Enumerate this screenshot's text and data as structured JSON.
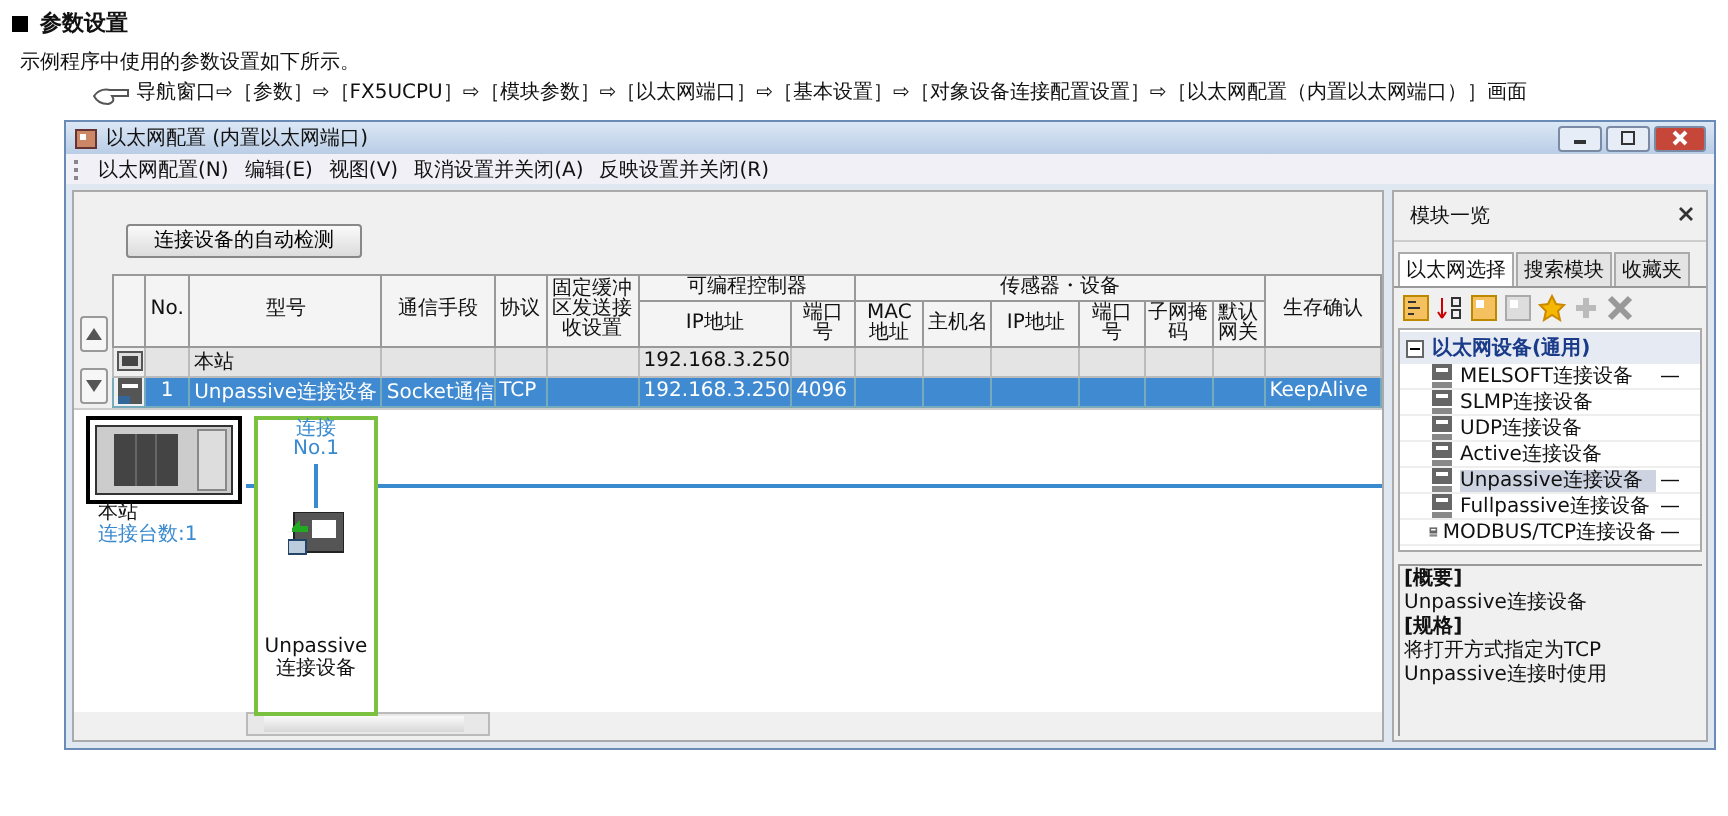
{
  "heading": "参数设置",
  "intro": "示例程序中使用的参数设置如下所示。",
  "nav_path": "导航窗口⇨［参数］⇨［FX5UCPU］⇨［模块参数］⇨［以太网端口］⇨［基本设置］⇨［对象设备连接配置设置］⇨［以太网配置（内置以太网端口）］画面",
  "window": {
    "title": "以太网配置 (内置以太网端口)"
  },
  "menu": [
    "以太网配置(N)",
    "编辑(E)",
    "视图(V)",
    "取消设置并关闭(A)",
    "反映设置并关闭(R)"
  ],
  "auto_detect_button": "连接设备的自动检测",
  "table": {
    "column_groups": [
      {
        "label": "可编程控制器"
      },
      {
        "label": "传感器・设备"
      }
    ],
    "columns": [
      {
        "label": "No."
      },
      {
        "label": "型号"
      },
      {
        "label": "通信手段"
      },
      {
        "label": "协议"
      },
      {
        "label": "固定缓冲区发送接收设置"
      },
      {
        "label": "IP地址",
        "grouped": true,
        "group_start": true
      },
      {
        "label": "端口号",
        "grouped": true
      },
      {
        "label": "MAC地址",
        "grouped": true,
        "group_start": true
      },
      {
        "label": "主机名",
        "grouped": true
      },
      {
        "label": "IP地址",
        "grouped": true
      },
      {
        "label": "端口号",
        "grouped": true
      },
      {
        "label": "子网掩码",
        "grouped": true
      },
      {
        "label": "默认网关",
        "grouped": true
      },
      {
        "label": "生存确认"
      }
    ],
    "rows": [
      {
        "kind": "station",
        "selected": false,
        "cells": [
          null,
          "本站",
          null,
          null,
          null,
          "192.168.3.250",
          null,
          null,
          null,
          null,
          null,
          null,
          null,
          null
        ]
      },
      {
        "kind": "unpassive",
        "selected": true,
        "cells": [
          "1",
          "Unpassive连接设备",
          "Socket通信",
          "TCP",
          null,
          "192.168.3.250",
          "4096",
          null,
          null,
          null,
          null,
          null,
          null,
          "KeepAlive"
        ]
      }
    ]
  },
  "diagram": {
    "station": {
      "name": "本站",
      "count": "连接台数:1"
    },
    "connections": [
      {
        "label": "连接",
        "number": "No.1",
        "device": "Unpassive 连接设备",
        "selected": true
      }
    ]
  },
  "module_list": {
    "title": "模块一览",
    "tabs": [
      {
        "label": "以太网选择",
        "selected": true
      },
      {
        "label": "搜索模块",
        "selected": false
      },
      {
        "label": "收藏夹",
        "selected": false
      }
    ],
    "tree": [
      {
        "label": "以太网设备(通用)",
        "expanded": true,
        "children": [
          {
            "label": "MELSOFT连接设备",
            "mark": "—",
            "selected": false
          },
          {
            "label": "SLMP连接设备",
            "selected": false
          },
          {
            "label": "UDP连接设备",
            "selected": false
          },
          {
            "label": "Active连接设备",
            "selected": false
          },
          {
            "label": "Unpassive连接设备",
            "mark": "—",
            "selected": true
          },
          {
            "label": "Fullpassive连接设备",
            "mark": "—",
            "selected": false
          },
          {
            "label": "MODBUS/TCP连接设备",
            "mark": "—",
            "selected": false
          }
        ]
      }
    ],
    "description": [
      {
        "kind": "heading",
        "text": "[概要]"
      },
      {
        "kind": "text",
        "text": "Unpassive连接设备"
      },
      {
        "kind": "heading",
        "text": "[规格]"
      },
      {
        "kind": "text",
        "text": "将打开方式指定为TCP Unpassive连接时使用"
      }
    ]
  }
}
